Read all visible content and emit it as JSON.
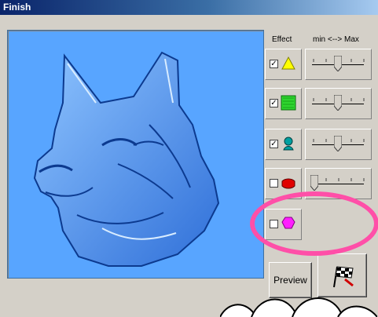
{
  "window": {
    "title": "Finish"
  },
  "columns": {
    "effect_label": "Effect",
    "minmax_label": "min <--> Max"
  },
  "effects": [
    {
      "name": "yellow-triangle",
      "checked": true,
      "check_mark": "✓",
      "color": "#ffff00",
      "slider_fraction": 0.5
    },
    {
      "name": "green-texture",
      "checked": true,
      "check_mark": "✓",
      "color": "#2fd52f",
      "slider_fraction": 0.5
    },
    {
      "name": "teal-figure",
      "checked": true,
      "check_mark": "✓",
      "color": "#00a0a0",
      "slider_fraction": 0.5
    },
    {
      "name": "red-shape",
      "checked": false,
      "check_mark": "",
      "color": "#e00000",
      "slider_fraction": 0.0
    },
    {
      "name": "magenta-polygon",
      "checked": false,
      "check_mark": "",
      "color": "#ff1fff",
      "slider_fraction": null
    }
  ],
  "buttons": {
    "preview_label": "Preview",
    "finish_icon": "checkered-flag-icon"
  },
  "colors": {
    "preview_bg": "#58a5ff",
    "highlight": "#ff4fa8",
    "title_gradient_start": "#0a246a"
  }
}
